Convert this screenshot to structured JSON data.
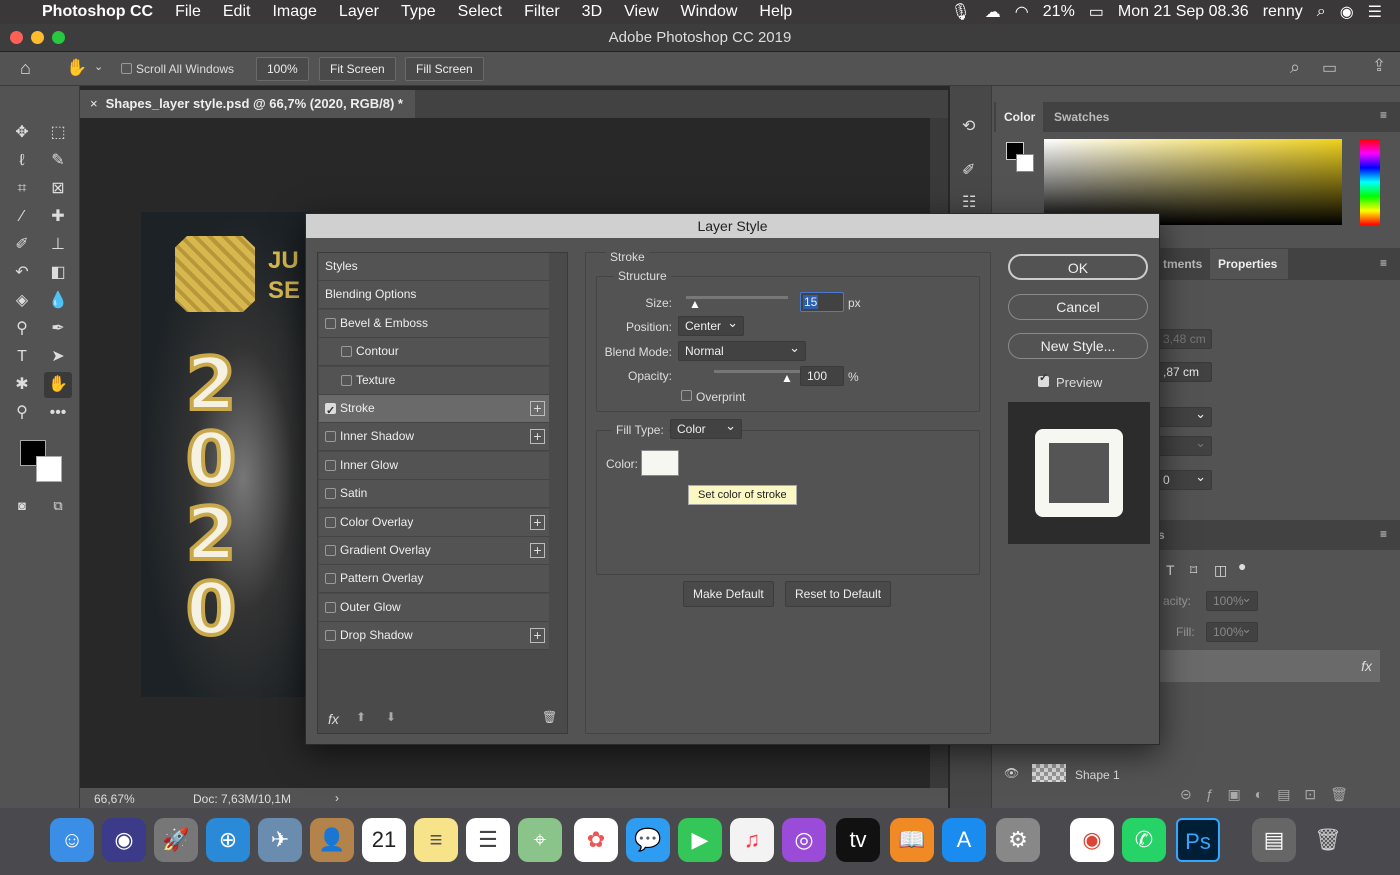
{
  "menubar": {
    "app": "Photoshop CC",
    "items": [
      "File",
      "Edit",
      "Image",
      "Layer",
      "Type",
      "Select",
      "Filter",
      "3D",
      "View",
      "Window",
      "Help"
    ],
    "battery": "21%",
    "datetime": "Mon 21 Sep  08.36",
    "user": "renny"
  },
  "window": {
    "title": "Adobe Photoshop CC 2019"
  },
  "options": {
    "scroll_all": "Scroll All Windows",
    "zoom": "100%",
    "fit_screen": "Fit Screen",
    "fill_screen": "Fill Screen"
  },
  "document": {
    "tab": "Shapes_layer style.psd @ 66,7% (2020, RGB/8) *",
    "art_text": "JU SE",
    "digits": [
      "2",
      "0",
      "2",
      "0"
    ]
  },
  "status": {
    "zoom": "66,67%",
    "doc": "Doc: 7,63M/10,1M"
  },
  "panels": {
    "color_tab": "Color",
    "swatches_tab": "Swatches",
    "adjustments_tab": "tments",
    "properties_tab": "Properties",
    "prop_w": "3,48 cm",
    "prop_h": ",87 cm",
    "prop_val": "0",
    "layers_tab": "s",
    "opacity_label": "acity:",
    "opacity": "100%",
    "fill_label": "Fill:",
    "fill": "100%",
    "fx": "fx",
    "layer_name": "Shape 1"
  },
  "dialog": {
    "title": "Layer Style",
    "styles": [
      {
        "label": "Styles",
        "check": null,
        "plus": false,
        "indent": false
      },
      {
        "label": "Blending Options",
        "check": null,
        "plus": false,
        "indent": false
      },
      {
        "label": "Bevel & Emboss",
        "check": false,
        "plus": false,
        "indent": false
      },
      {
        "label": "Contour",
        "check": false,
        "plus": false,
        "indent": true
      },
      {
        "label": "Texture",
        "check": false,
        "plus": false,
        "indent": true
      },
      {
        "label": "Stroke",
        "check": true,
        "plus": true,
        "indent": false
      },
      {
        "label": "Inner Shadow",
        "check": false,
        "plus": true,
        "indent": false
      },
      {
        "label": "Inner Glow",
        "check": false,
        "plus": false,
        "indent": false
      },
      {
        "label": "Satin",
        "check": false,
        "plus": false,
        "indent": false
      },
      {
        "label": "Color Overlay",
        "check": false,
        "plus": true,
        "indent": false
      },
      {
        "label": "Gradient Overlay",
        "check": false,
        "plus": true,
        "indent": false
      },
      {
        "label": "Pattern Overlay",
        "check": false,
        "plus": false,
        "indent": false
      },
      {
        "label": "Outer Glow",
        "check": false,
        "plus": false,
        "indent": false
      },
      {
        "label": "Drop Shadow",
        "check": false,
        "plus": true,
        "indent": false
      }
    ],
    "fx": "fx",
    "stroke": {
      "title": "Stroke",
      "structure": "Structure",
      "size_label": "Size:",
      "size": "15",
      "size_unit": "px",
      "size_fraction": 0.1,
      "position_label": "Position:",
      "position": "Center",
      "blend_label": "Blend Mode:",
      "blend": "Normal",
      "opacity_label": "Opacity:",
      "opacity": "100",
      "opacity_unit": "%",
      "opacity_fraction": 1.0,
      "overprint": "Overprint",
      "fill_type_label": "Fill Type:",
      "fill_type": "Color",
      "color_label": "Color:",
      "color": "#f7f7f2",
      "tooltip": "Set color of stroke",
      "make_default": "Make Default",
      "reset_default": "Reset to Default"
    },
    "ok": "OK",
    "cancel": "Cancel",
    "new_style": "New Style...",
    "preview": "Preview"
  }
}
